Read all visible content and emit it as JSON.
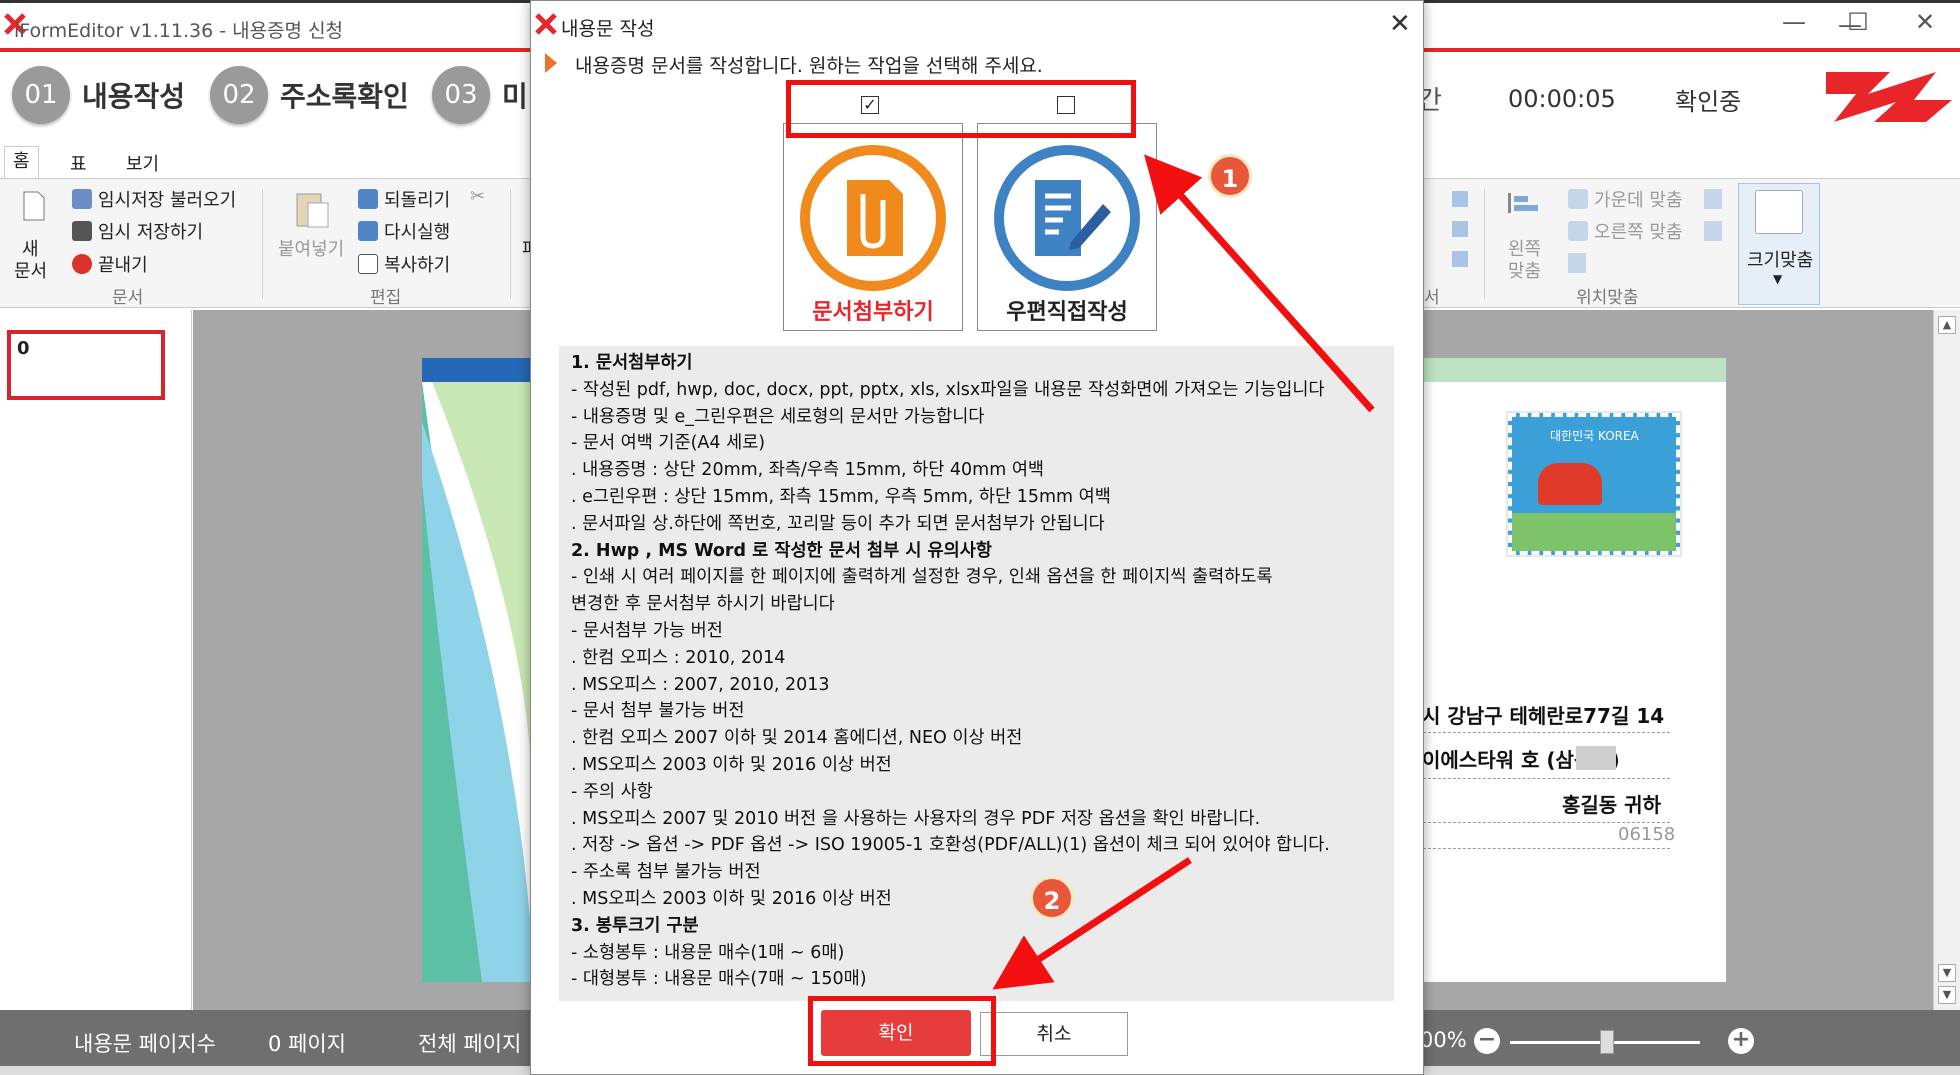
{
  "window": {
    "title": "iFormEditor v1.11.36 - 내용증명 신청",
    "minimize_icon": "minimize-icon",
    "maximize_icon": "maximize-icon",
    "close_icon": "close-icon"
  },
  "steps": [
    {
      "num": "01",
      "label": "내용작성"
    },
    {
      "num": "02",
      "label": "주소록확인"
    },
    {
      "num": "03",
      "label": "미"
    }
  ],
  "header": {
    "partial_step": "간",
    "timer": "00:00:05",
    "status": "확인중"
  },
  "menu": {
    "tabs": [
      "홈",
      "표",
      "보기"
    ]
  },
  "ribbon": {
    "new_doc_line1": "새",
    "new_doc_line2": "문서",
    "load_temp": "임시저장 불러오기",
    "save_temp": "임시 저장하기",
    "close": "끝내기",
    "group_doc": "문서",
    "paste": "붙여넣기",
    "undo": "되돌리기",
    "redo": "다시실행",
    "copy": "복사하기",
    "group_edit": "편집",
    "partial_group": "서",
    "align_left_line1": "왼쪽",
    "align_left_line2": "맞춤",
    "align_center": "가운데 맞춤",
    "align_right": "오른쪽 맞춤",
    "group_position": "위치맞춤",
    "fit_size": "크기맞춤",
    "partial_label": "파"
  },
  "thumbnail": {
    "number": "0"
  },
  "document": {
    "stamp_text": "대한민국 KOREA",
    "address_line1": "시 강남구 테헤란로77길 14",
    "address_line2": "이에스타워       호 (삼성동)",
    "recipient": "홍길동 귀하",
    "zip": "06158"
  },
  "statusbar": {
    "page_count_label": "내용문 페이지수",
    "page_count_value": "0 페이지",
    "total_label": "전체 페이지",
    "zoom_value": "00%"
  },
  "dialog": {
    "title": "내용문 작성",
    "close_icon": "close-icon",
    "instruction": "내용증명 문서를 작성합니다. 원하는 작업을 선택해 주세요.",
    "options": [
      {
        "label": "문서첨부하기",
        "checked": true,
        "color": "#e8262a",
        "ring": "#f08a1c"
      },
      {
        "label": "우편직접작성",
        "checked": false,
        "color": "#222222",
        "ring": "#3f82c4"
      }
    ],
    "info_lines": [
      {
        "text": "1. 문서첨부하기",
        "bold": true
      },
      {
        "text": " - 작성된 pdf, hwp, doc, docx, ppt, pptx, xls, xlsx파일을 내용문 작성화면에 가져오는 기능입니다",
        "bold": false
      },
      {
        "text": " - 내용증명 및 e_그린우편은 세로형의 문서만 가능합니다",
        "bold": false
      },
      {
        "text": " - 문서 여백 기준(A4 세로)",
        "bold": false
      },
      {
        "text": "   . 내용증명  : 상단 20mm, 좌측/우측 15mm, 하단 40mm 여백",
        "bold": false
      },
      {
        "text": "   . e그린우편 : 상단 15mm, 좌측 15mm, 우측 5mm, 하단 15mm 여백",
        "bold": false
      },
      {
        "text": "   . 문서파일 상.하단에 쪽번호, 꼬리말 등이 추가 되면 문서첨부가 안됩니다",
        "bold": false
      },
      {
        "text": "2. Hwp , MS Word 로 작성한 문서 첨부 시  유의사항",
        "bold": true
      },
      {
        "text": " - 인쇄 시 여러 페이지를 한 페이지에  출력하게 설정한 경우, 인쇄 옵션을 한 페이지씩 출력하도록",
        "bold": false
      },
      {
        "text": "   변경한 후 문서첨부 하시기 바랍니다",
        "bold": false
      },
      {
        "text": " - 문서첨부 가능 버전",
        "bold": false
      },
      {
        "text": "   . 한컴 오피스 : 2010, 2014",
        "bold": false
      },
      {
        "text": "   . MS오피스 : 2007, 2010, 2013",
        "bold": false
      },
      {
        "text": " - 문서 첨부 불가능 버전",
        "bold": false
      },
      {
        "text": "   . 한컴 오피스 2007 이하 및 2014 홈에디션, NEO 이상 버전",
        "bold": false
      },
      {
        "text": "   . MS오피스 2003 이하 및 2016 이상 버전",
        "bold": false
      },
      {
        "text": " - 주의 사항",
        "bold": false
      },
      {
        "text": "   . MS오피스 2007 및 2010 버전 을 사용하는 사용자의 경우 PDF 저장 옵션을 확인 바랍니다.",
        "bold": false
      },
      {
        "text": "   . 저장 -> 옵션 -> PDF 옵션 -> ISO 19005-1 호환성(PDF/ALL)(1) 옵션이 체크 되어 있어야 합니다.",
        "bold": false
      },
      {
        "text": " - 주소록 첨부 불가능 버전",
        "bold": false
      },
      {
        "text": "   . MS오피스 2003 이하 및 2016 이상 버전",
        "bold": false
      },
      {
        "text": "3. 봉투크기 구분",
        "bold": true
      },
      {
        "text": " - 소형봉투 : 내용문 매수(1매 ~ 6매)",
        "bold": false
      },
      {
        "text": " - 대형봉투 : 내용문 매수(7매 ~ 150매)",
        "bold": false
      }
    ],
    "ok_label": "확인",
    "cancel_label": "취소"
  },
  "annotations": {
    "badge1": "1",
    "badge2": "2",
    "color": "#f10f0f"
  }
}
